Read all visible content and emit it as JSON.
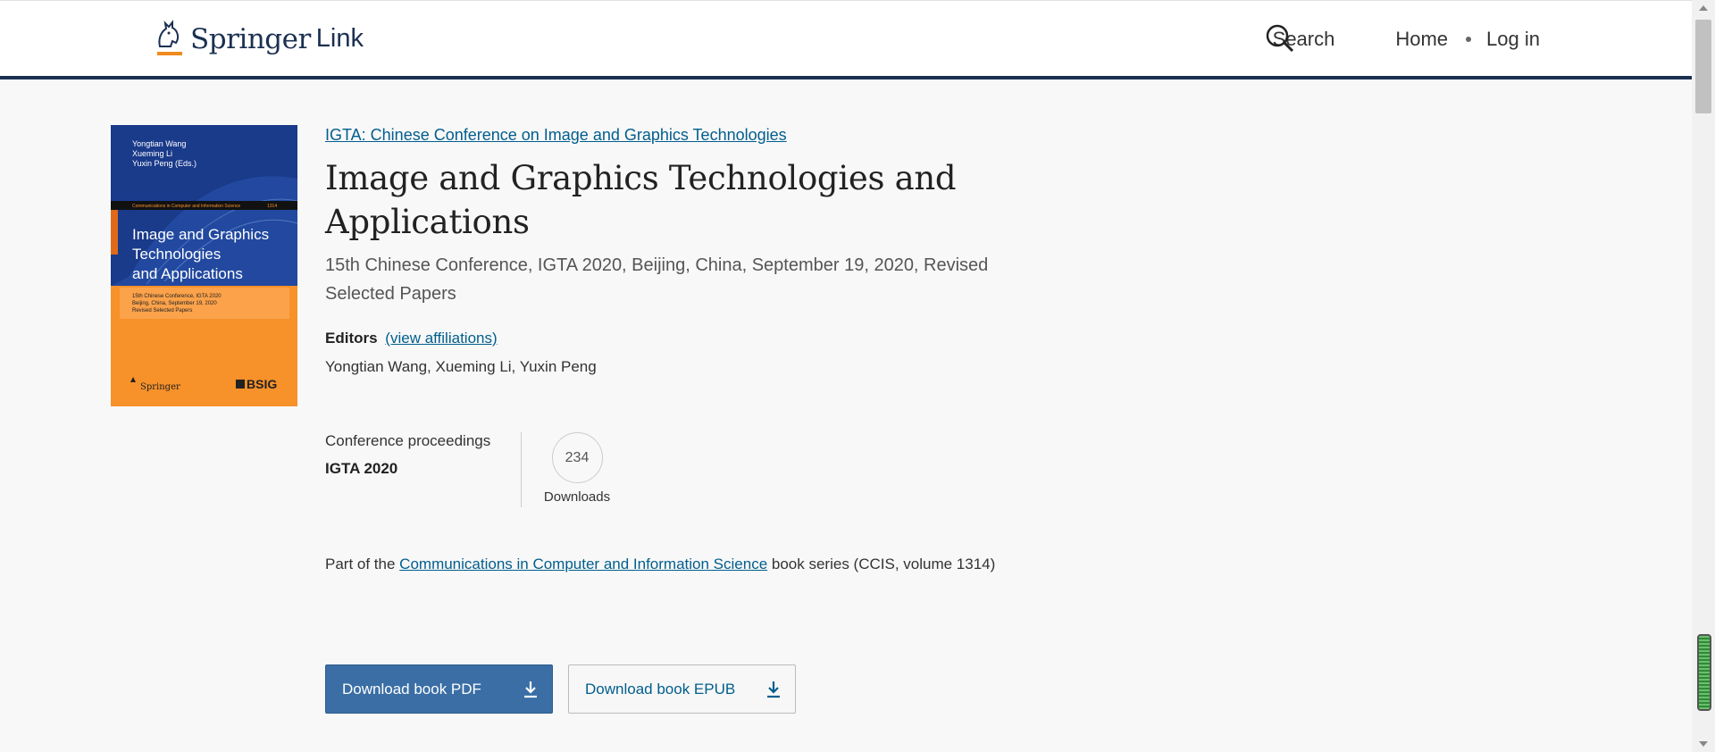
{
  "header": {
    "brand_primary": "Springer",
    "brand_secondary": "Link",
    "nav": {
      "search_label": "Search",
      "home_label": "Home",
      "login_label": "Log in"
    }
  },
  "cover": {
    "editors": [
      "Yongtian Wang",
      "Xueming Li",
      "Yuxin Peng (Eds.)"
    ],
    "series_strip": "Communications in Computer and Information Science",
    "series_number": "1314",
    "title_lines": [
      "Image and Graphics",
      "Technologies",
      "and Applications"
    ],
    "sub_lines": [
      "15th Chinese Conference, IGTA 2020",
      "Beijing, China, September 19, 2020",
      "Revised Selected Papers"
    ],
    "publisher": "Springer",
    "partner": "BSIG"
  },
  "book": {
    "conference_link": "IGTA: Chinese Conference on Image and Graphics Technologies",
    "title": "Image and Graphics Technologies and Applications",
    "subtitle": "15th Chinese Conference, IGTA 2020, Beijing, China, September 19, 2020, Revised Selected Papers",
    "editors_label": "Editors",
    "affiliations_link": "(view affiliations)",
    "editors": "Yongtian Wang, Xueming Li, Yuxin Peng",
    "proceedings_type": "Conference proceedings",
    "proceedings_name": "IGTA 2020",
    "downloads_count": "234",
    "downloads_label": "Downloads",
    "series_prefix": "Part of the",
    "series_link": "Communications in Computer and Information Science",
    "series_suffix": "book series (CCIS, volume 1314)",
    "download_pdf_label": "Download book PDF",
    "download_epub_label": "Download book EPUB"
  },
  "colors": {
    "brand_navy": "#1b3051",
    "link_blue": "#025e8d",
    "primary_button": "#3a6ea5",
    "cover_blue": "#1a3a8a",
    "cover_orange": "#f7912a"
  }
}
